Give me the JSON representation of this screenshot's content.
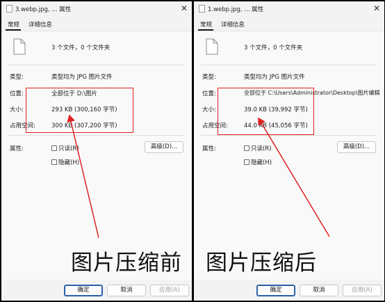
{
  "windows": [
    {
      "title": "3.webp.jpg, ... 属性",
      "tabs": [
        "常规",
        "详细信息"
      ],
      "summary": "3 个文件，0 个文件夹",
      "props": [
        {
          "label": "类型:",
          "value": "类型均为 JPG 图片文件"
        },
        {
          "label": "位置:",
          "value": "全部位于 D:\\图片"
        },
        {
          "label": "大小:",
          "value": "293 KB (300,160 字节)"
        },
        {
          "label": "占用空间:",
          "value": "300 KB (307,200 字节)"
        }
      ],
      "attr_label": "属性:",
      "readonly": "只读(R)",
      "hidden": "隐藏(H)",
      "advanced": "高级(D)...",
      "ok": "确定",
      "cancel": "取消",
      "apply": "应用(A)",
      "caption": "图片压缩前"
    },
    {
      "title": "1.webp.jpg, ... 属性",
      "tabs": [
        "常规",
        "详细信息"
      ],
      "summary": "3 个文件，0 个文件夹",
      "props": [
        {
          "label": "类型:",
          "value": "类型均为 JPG 图片文件"
        },
        {
          "label": "位置:",
          "value": "全部位于 C:\\Users\\Administrator\\Desktop\\图片编辑"
        },
        {
          "label": "大小:",
          "value": "39.0 KB (39,992 字节)"
        },
        {
          "label": "占用空间:",
          "value": "44.0 KB (45,056 字节)"
        }
      ],
      "attr_label": "属性:",
      "readonly": "只读(R)",
      "hidden": "隐藏(H)",
      "advanced": "高级(D)...",
      "ok": "确定",
      "cancel": "取消",
      "apply": "应用(A)",
      "caption": "图片压缩后"
    }
  ],
  "colors": {
    "annotation": "#e02020",
    "ok_border": "#2a5fa8"
  }
}
